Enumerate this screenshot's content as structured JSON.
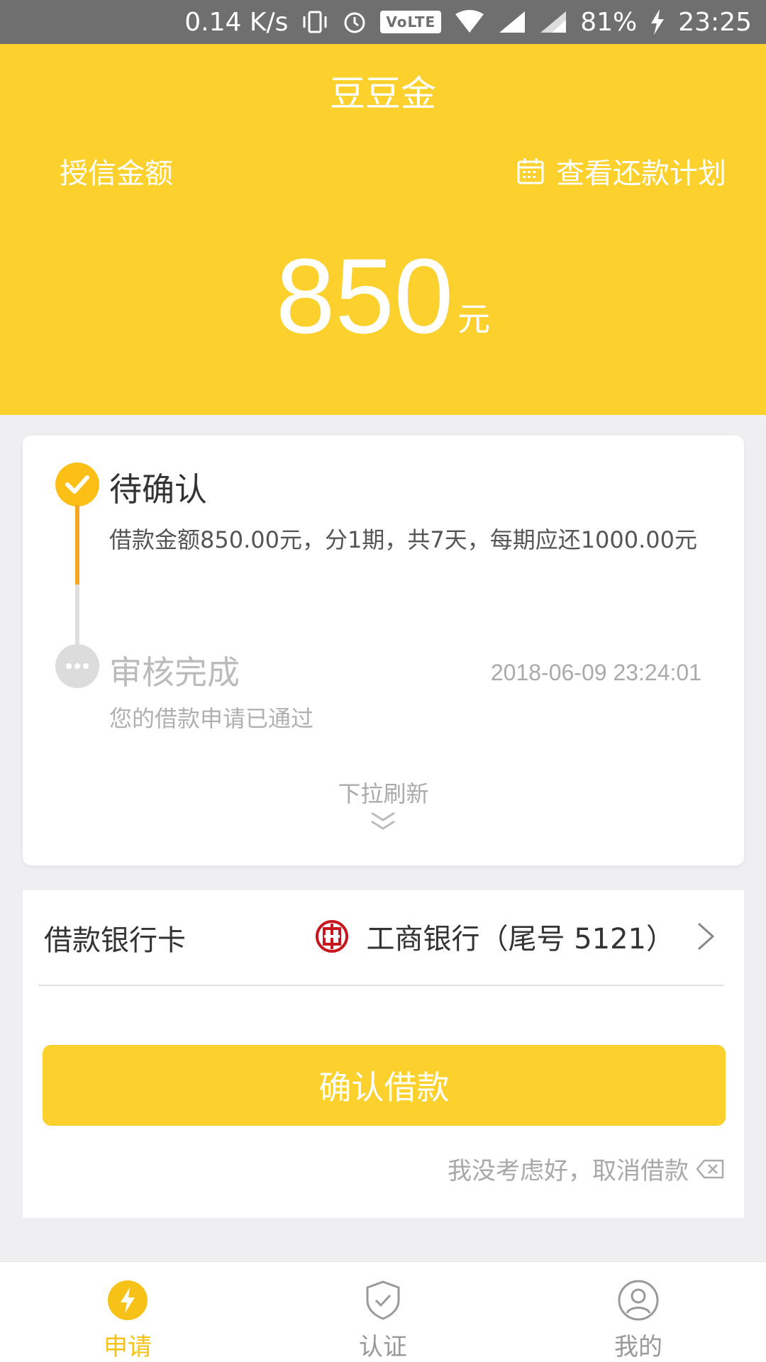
{
  "status_bar": {
    "net_speed": "0.14 K/s",
    "volte": "VoLTE",
    "battery": "81%",
    "time": "23:25"
  },
  "header": {
    "title": "豆豆金",
    "credit_label": "授信金额",
    "plan_link": "查看还款计划",
    "amount": "850",
    "unit": "元"
  },
  "progress": {
    "step1": {
      "title": "待确认",
      "desc": "借款金额850.00元，分1期，共7天，每期应还1000.00元"
    },
    "step2": {
      "title": "审核完成",
      "time": "2018-06-09 23:24:01",
      "desc": "您的借款申请已通过"
    },
    "pull_hint": "下拉刷新"
  },
  "bank": {
    "label": "借款银行卡",
    "value": "工商银行（尾号 5121）"
  },
  "confirm_label": "确认借款",
  "cancel_label": "我没考虑好，取消借款",
  "nav": [
    {
      "label": "申请"
    },
    {
      "label": "认证"
    },
    {
      "label": "我的"
    }
  ],
  "colors": {
    "brand": "#fdd12d",
    "accent": "#f6c218",
    "progress_line": "#f5a623"
  }
}
